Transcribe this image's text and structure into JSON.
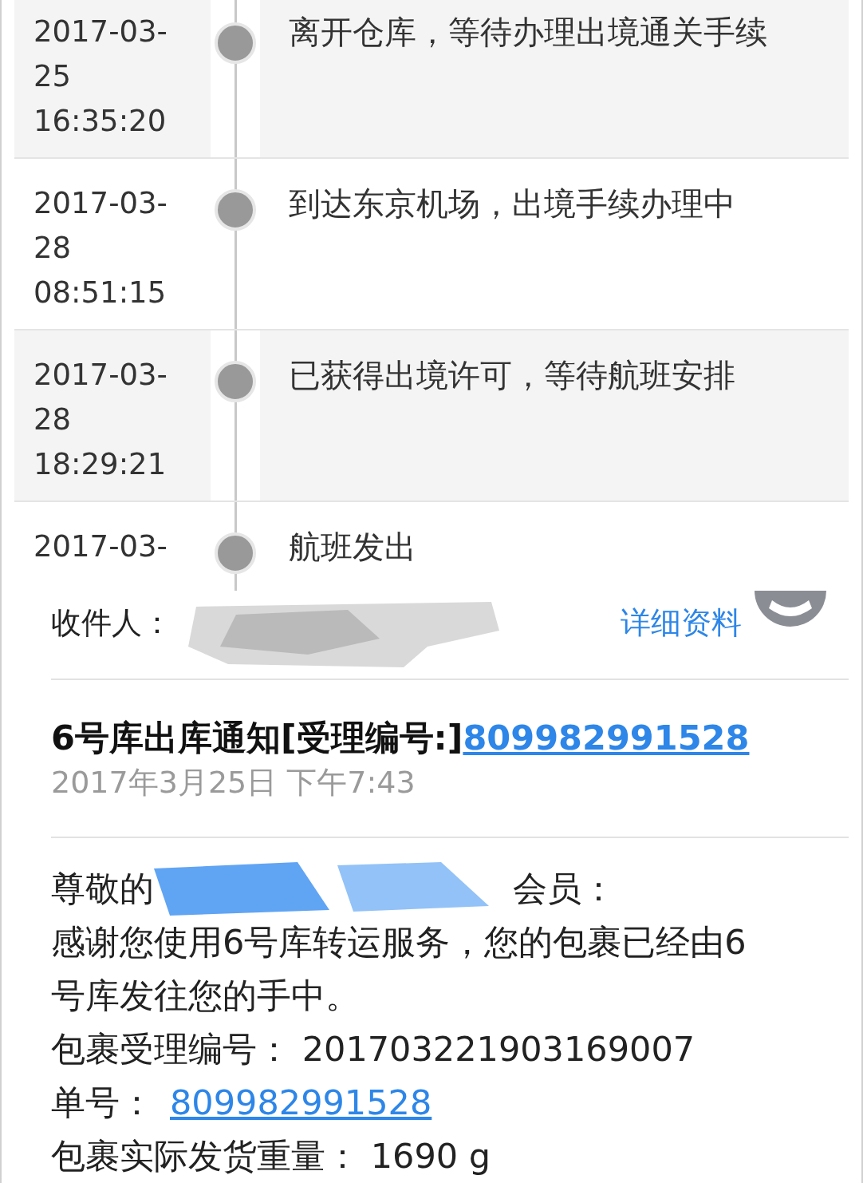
{
  "tracking": [
    {
      "date": "2017-03-25",
      "time": "16:35:20",
      "event": "离开仓库，等待办理出境通关手续"
    },
    {
      "date": "2017-03-28",
      "time": "08:51:15",
      "event": "到达东京机场，出境手续办理中"
    },
    {
      "date": "2017-03-28",
      "time": "18:29:21",
      "event": "已获得出境许可，等待航班安排"
    },
    {
      "date": "2017-03-",
      "event": "航班发出"
    }
  ],
  "email": {
    "recipient_label": "收件人：",
    "details_link": "详细资料",
    "subject": "6号库出库通知[受理编号:]",
    "subject_link": "809982991528",
    "sent": "2017年3月25日 下午7:43",
    "greeting_start": "尊敬的",
    "greeting_end": "会员：",
    "body": [
      {
        "kind": "text",
        "text": "感谢您使用6号库转运服务，您的包裹已经由6号库发往您的手中。"
      },
      {
        "kind": "text",
        "text": "包裹受理编号：  201703221903169007"
      },
      {
        "kind": "link",
        "label": "单号：",
        "link": "809982991528"
      },
      {
        "kind": "text",
        "text": "包裹实际发货重量：  1690 g"
      }
    ]
  }
}
